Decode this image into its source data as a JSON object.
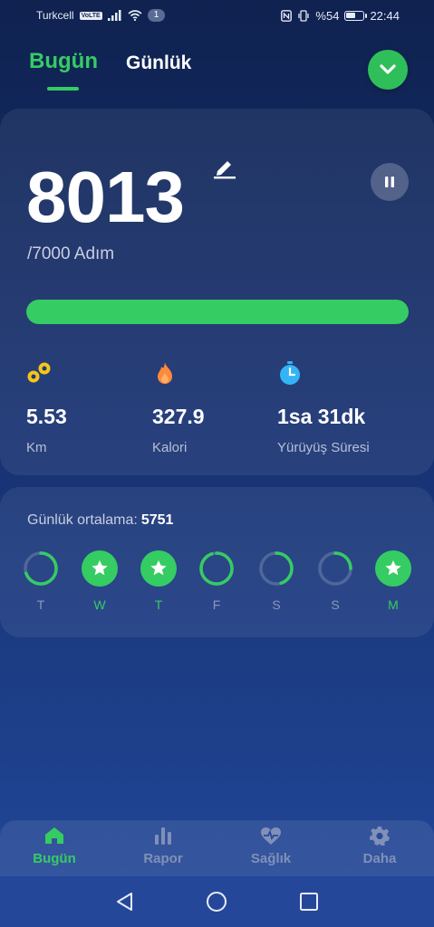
{
  "status_bar": {
    "carrier": "Turkcell",
    "volte": "VoLTE",
    "notification_count": "1",
    "battery": "%54",
    "time": "22:44"
  },
  "header": {
    "tabs": [
      {
        "label": "Bugün",
        "active": true
      },
      {
        "label": "Günlük",
        "active": false
      }
    ],
    "accent_color": "#35cc63"
  },
  "steps": {
    "value": "8013",
    "goal_text": "/7000 Adım",
    "progress_fraction": 1.0
  },
  "stats": [
    {
      "icon": "footprints-icon",
      "value": "5.53",
      "label": "Km",
      "color": "#f5c518"
    },
    {
      "icon": "flame-icon",
      "value": "327.9",
      "label": "Kalori",
      "color": "#ff8a3d"
    },
    {
      "icon": "stopwatch-icon",
      "value": "1sa 31dk",
      "label": "Yürüyüş Süresi",
      "color": "#33b5f5"
    }
  ],
  "weekly": {
    "average_label": "Günlük ortalama:",
    "average_value": "5751",
    "days": [
      {
        "label": "T",
        "completed": false,
        "fraction": 0.7
      },
      {
        "label": "W",
        "completed": true,
        "fraction": 1.0
      },
      {
        "label": "T",
        "completed": true,
        "fraction": 1.0
      },
      {
        "label": "F",
        "completed": false,
        "fraction": 0.95
      },
      {
        "label": "S",
        "completed": false,
        "fraction": 0.45
      },
      {
        "label": "S",
        "completed": false,
        "fraction": 0.25
      },
      {
        "label": "M",
        "completed": true,
        "fraction": 1.0
      }
    ]
  },
  "bottom_nav": [
    {
      "label": "Bugün",
      "icon": "home-icon",
      "active": true
    },
    {
      "label": "Rapor",
      "icon": "bar-chart-icon",
      "active": false
    },
    {
      "label": "Sağlık",
      "icon": "heart-pulse-icon",
      "active": false
    },
    {
      "label": "Daha",
      "icon": "gear-icon",
      "active": false
    }
  ]
}
